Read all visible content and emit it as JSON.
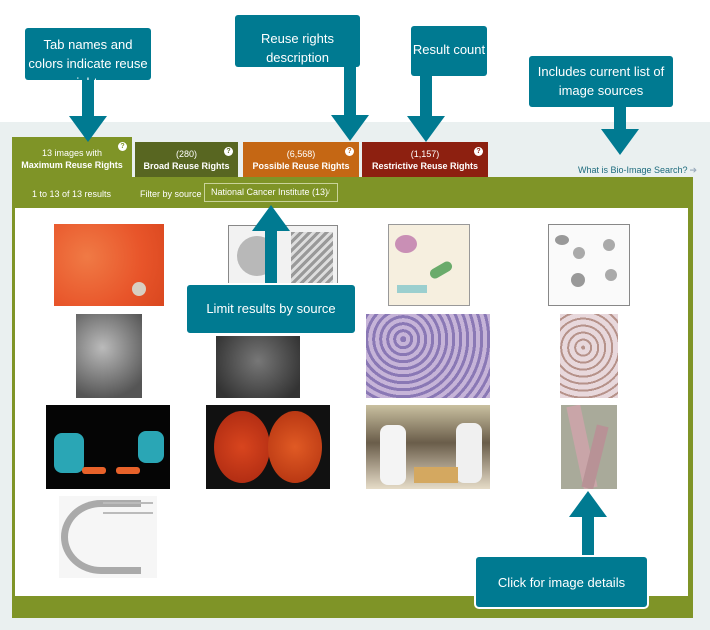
{
  "callouts": {
    "tab_names": "Tab names and colors indicate reuse rights",
    "reuse_desc": "Reuse rights description",
    "result_count": "Result count",
    "sources": "Includes current list of image sources",
    "limit_source": "Limit results by source",
    "image_details": "Click for image details"
  },
  "tabs": [
    {
      "count": "13 images with",
      "name": "Maximum Reuse Rights",
      "help": "?",
      "color": "#7f9427",
      "active": true
    },
    {
      "count": "(280)",
      "name": "Broad Reuse Rights",
      "help": "?",
      "color": "#586621"
    },
    {
      "count": "(6,568)",
      "name": "Possible Reuse Rights",
      "help": "?",
      "color": "#c56714"
    },
    {
      "count": "(1,157)",
      "name": "Restrictive Reuse Rights",
      "help": "?",
      "color": "#8d2010"
    }
  ],
  "what_link": {
    "label": "What is Bio-Image Search?",
    "icon": "arrow-right-icon"
  },
  "toolbar": {
    "results": "1 to 13 of 13 results",
    "filter_label": "Filter by source",
    "filter_value": "National Cancer Institute (13)",
    "filter_icon": "chevron-down-icon"
  },
  "images": [
    {
      "desc": "orange cells micrograph"
    },
    {
      "desc": "normal vs anemia blood vessel illustration"
    },
    {
      "desc": "antibody binding bacteria diagram"
    },
    {
      "desc": "blood cell lineage diagram"
    },
    {
      "desc": "red blood cells SEM"
    },
    {
      "desc": "platelets SEM"
    },
    {
      "desc": "purple tissue stain"
    },
    {
      "desc": "pink tissue stain"
    },
    {
      "desc": "tumor metastasis diagram"
    },
    {
      "desc": "petri dishes with red cultures"
    },
    {
      "desc": "lab workers photo"
    },
    {
      "desc": "blood vessel with tumor cells illustration"
    },
    {
      "desc": "skin cross-section diagram"
    }
  ],
  "colors": {
    "accent": "#007a91",
    "panel": "#7f9427",
    "background": "#eaf0f0"
  }
}
